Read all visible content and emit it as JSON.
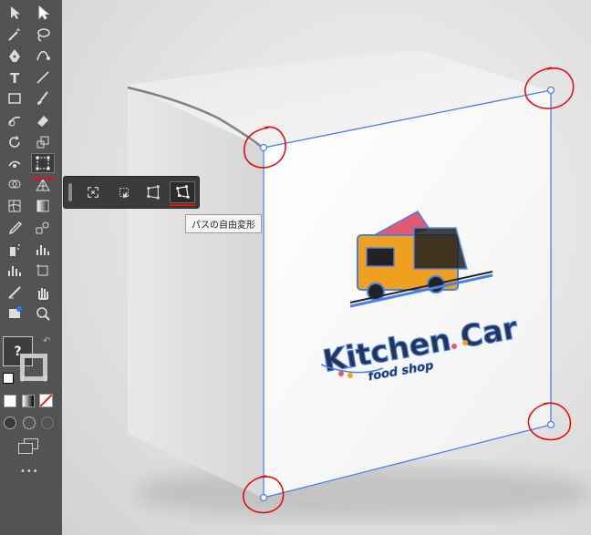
{
  "app": {
    "tooltip_text": "パスの自由変形",
    "fill_stroke_unknown": "?",
    "more_tools": "•••"
  },
  "tools": [
    {
      "name": "selection-tool-icon"
    },
    {
      "name": "direct-selection-tool-icon"
    },
    {
      "name": "magic-wand-tool-icon"
    },
    {
      "name": "lasso-tool-icon"
    },
    {
      "name": "pen-tool-icon"
    },
    {
      "name": "curvature-tool-icon"
    },
    {
      "name": "type-tool-icon",
      "glyph": "T"
    },
    {
      "name": "line-segment-tool-icon"
    },
    {
      "name": "rectangle-tool-icon"
    },
    {
      "name": "paintbrush-tool-icon"
    },
    {
      "name": "shaper-tool-icon"
    },
    {
      "name": "eraser-tool-icon"
    },
    {
      "name": "rotate-tool-icon"
    },
    {
      "name": "scale-tool-icon"
    },
    {
      "name": "puppet-warp-tool-icon"
    },
    {
      "name": "free-transform-tool-icon",
      "active": true
    },
    {
      "name": "shape-builder-tool-icon"
    },
    {
      "name": "perspective-grid-tool-icon"
    },
    {
      "name": "mesh-tool-icon"
    },
    {
      "name": "gradient-tool-icon"
    },
    {
      "name": "eyedropper-tool-icon"
    },
    {
      "name": "blend-tool-icon"
    },
    {
      "name": "symbol-sprayer-tool-icon"
    },
    {
      "name": "column-graph-tool-icon"
    },
    {
      "name": "bar-graph-tool-icon"
    },
    {
      "name": "artboard-tool-icon"
    },
    {
      "name": "slice-tool-icon"
    },
    {
      "name": "hand-tool-icon"
    },
    {
      "name": "print-tiling-tool-icon"
    },
    {
      "name": "zoom-tool-icon"
    }
  ],
  "free_transform_popup": {
    "options": [
      {
        "name": "constrain-icon"
      },
      {
        "name": "free-transform-option-icon"
      },
      {
        "name": "perspective-distort-icon"
      },
      {
        "name": "free-distort-icon",
        "selected": true
      }
    ]
  },
  "artwork": {
    "title": "Kitchen Car",
    "subtitle": "food shop"
  },
  "colors": {
    "toolbar_bg": "#535353",
    "selection_blue": "#4a7fe8",
    "annotation_red": "#e01010",
    "truck_yellow": "#f0a020",
    "truck_pink": "#e25a72"
  }
}
